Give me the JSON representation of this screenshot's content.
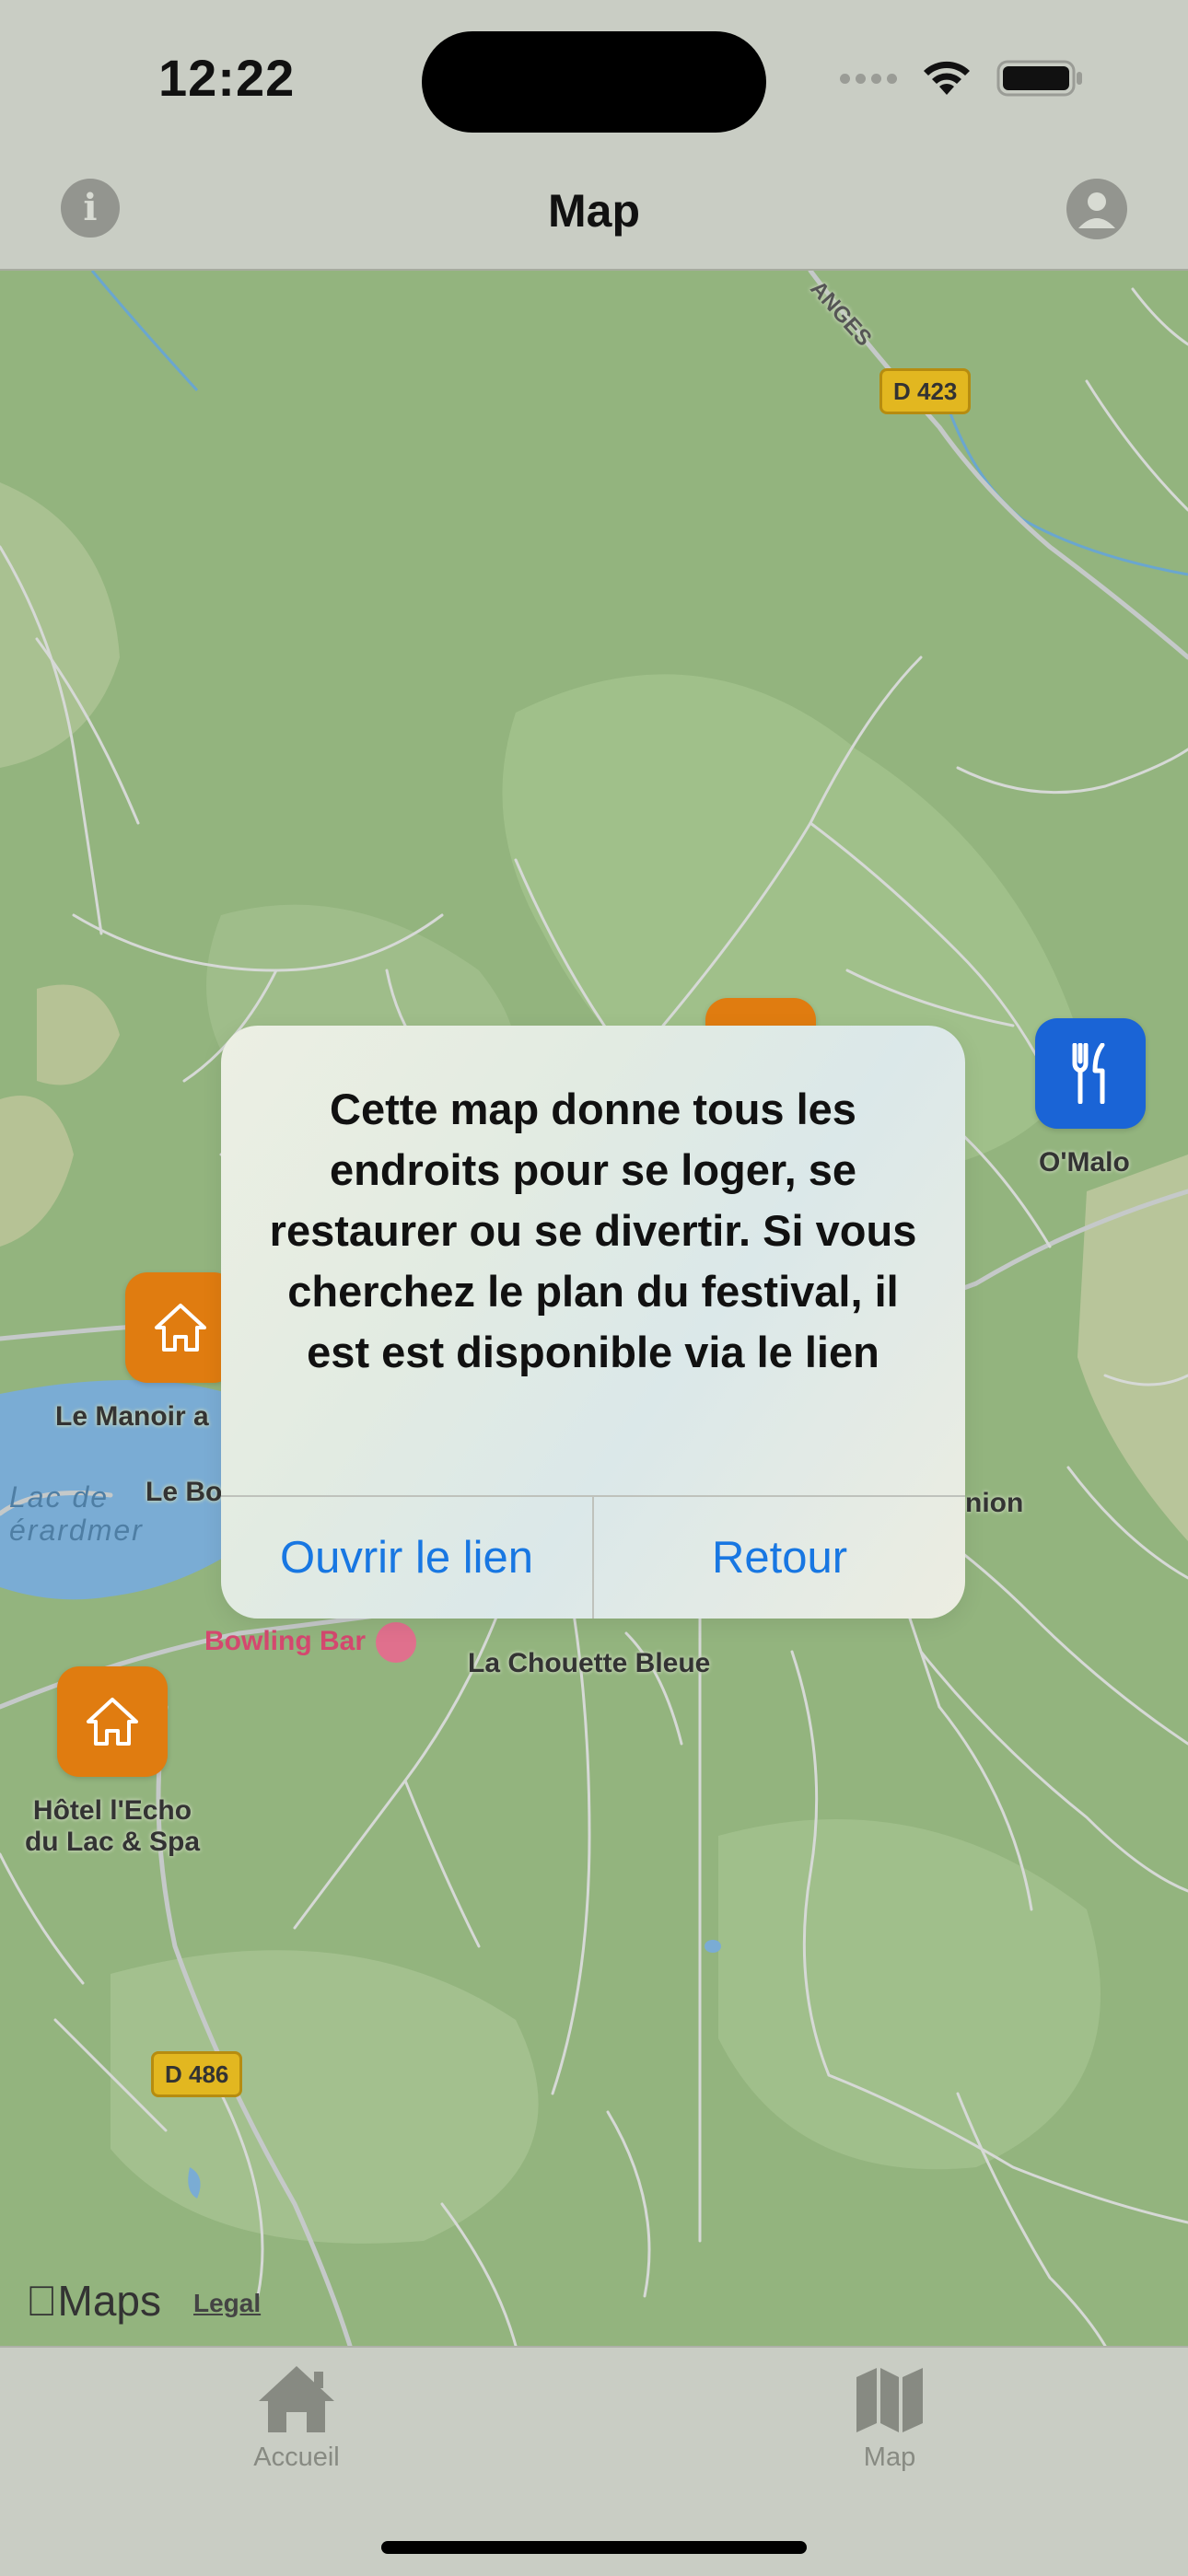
{
  "status_bar": {
    "time": "12:22"
  },
  "nav": {
    "title": "Map"
  },
  "map": {
    "places": [
      {
        "name": "Le Manoir a"
      },
      {
        "name": "Le Bo"
      },
      {
        "name": "Hôtel l'Echo\ndu Lac & Spa"
      },
      {
        "name": "O'Malo"
      },
      {
        "name": "La Chouette Bleue"
      },
      {
        "name": "nion"
      }
    ],
    "lake_label": "Lac de\nérardmer",
    "bowling_label": "Bowling Bar",
    "road_label_top": "ANGES",
    "roads": [
      "D 423",
      "D 486"
    ],
    "brand": "Maps",
    "legal": "Legal"
  },
  "alert": {
    "message": "Cette map donne tous les endroits pour se loger, se restaurer ou se divertir. Si vous cherchez le plan du festival, il est est disponible via le lien",
    "open_button": "Ouvrir le lien",
    "back_button": "Retour"
  },
  "tabs": [
    {
      "label": "Accueil",
      "icon": "house-icon"
    },
    {
      "label": "Map",
      "icon": "map-icon"
    }
  ],
  "colors": {
    "accent": "#1877e2",
    "marker_lodging": "#e07c10",
    "marker_food": "#1a64d6",
    "map_land": "#93b47e",
    "lake": "#7aacd4"
  }
}
